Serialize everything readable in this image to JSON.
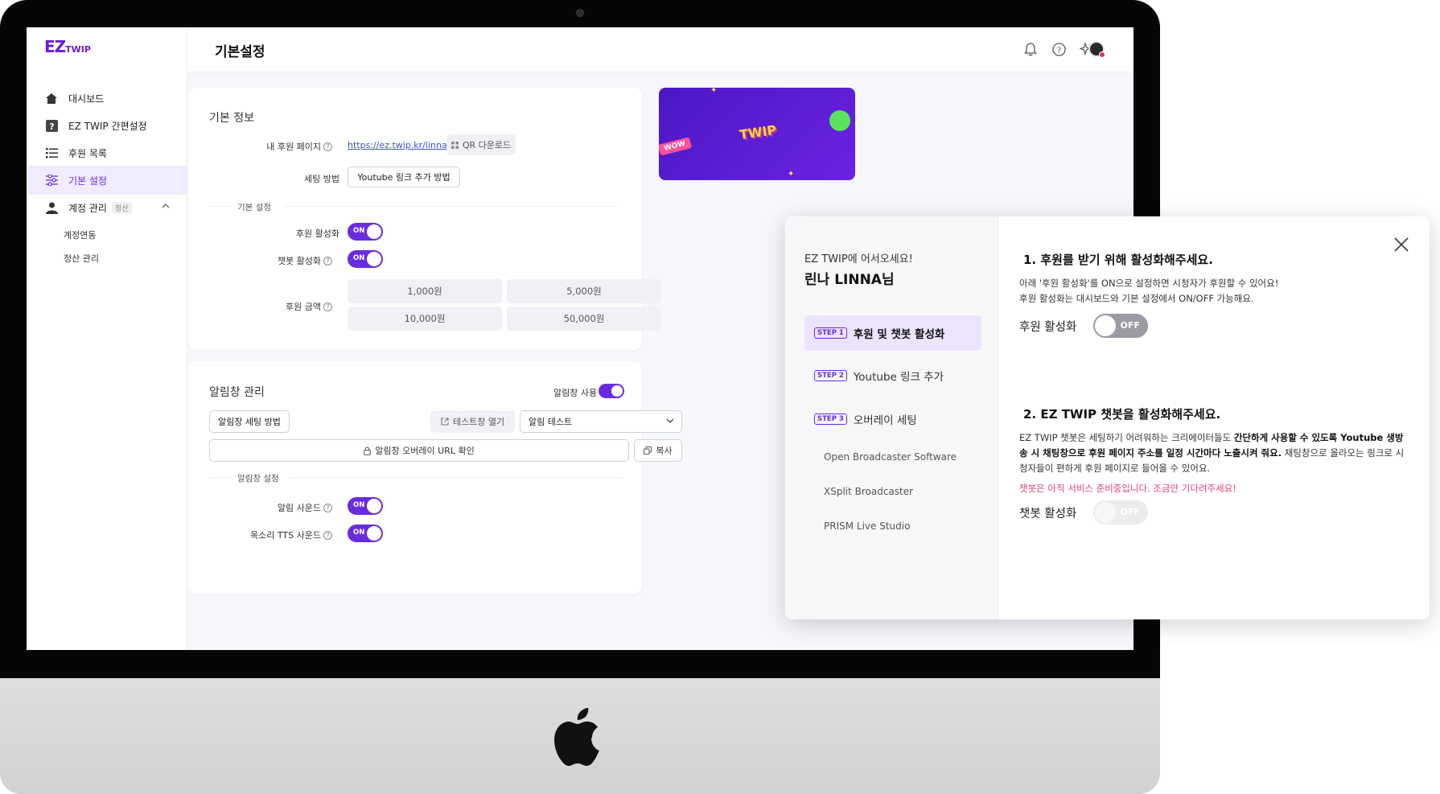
{
  "sidebar": {
    "logo": "EZ",
    "logo_sub": "TWIP",
    "items": [
      {
        "label": "대시보드",
        "icon": "home-icon"
      },
      {
        "label": "EZ TWIP 간편설정",
        "icon": "question-box-icon"
      },
      {
        "label": "후원 목록",
        "icon": "list-icon"
      },
      {
        "label": "기본 설정",
        "icon": "sliders-icon"
      },
      {
        "label": "계정 관리",
        "icon": "user-icon",
        "badge": "정산"
      }
    ],
    "sub_items": [
      "계정연동",
      "정산 관리"
    ]
  },
  "header": {
    "title": "기본설정",
    "icons": [
      "bell-icon",
      "help-icon",
      "sparkle-icon",
      "avatar"
    ]
  },
  "basic_info": {
    "title": "기본 정보",
    "page_label": "내 후원 페이지",
    "page_url": "https://ez.twip.kr/linna_",
    "qr_button": "QR 다운로드",
    "setting_label": "세팅 방법",
    "youtube_button": "Youtube 링크 추가 방법",
    "section_label": "기본 설정",
    "donation_toggle_label": "후원 활성화",
    "chatbot_toggle_label": "챗봇 활성화",
    "amount_label": "후원 금액",
    "amounts": [
      "1,000원",
      "5,000원",
      "10,000원",
      "50,000원"
    ],
    "toggle_on_text": "ON"
  },
  "alert": {
    "title": "알림창 관리",
    "use_label": "알림창 사용",
    "setting_button": "알림창 세팅 방법",
    "test_open_button": "테스트창 열기",
    "test_select": "알림 테스트",
    "url_button": "알림창 오버레이 URL 확인",
    "copy_button": "복사",
    "section_label": "알림창 설정",
    "sound_label": "알림 사운드",
    "tts_label": "목소리 TTS 사운드",
    "toggle_on_text": "ON"
  },
  "banner": {
    "word": "TWIP",
    "badge": "WOW"
  },
  "dialog": {
    "welcome": "EZ TWIP에 어서오세요!",
    "user_name": "린나 LINNA님",
    "steps": [
      {
        "tag": "STEP 1",
        "label": "후원 및 챗봇 활성화"
      },
      {
        "tag": "STEP 2",
        "label": "Youtube 링크 추가"
      },
      {
        "tag": "STEP 3",
        "label": "오버레이 세팅"
      }
    ],
    "sub_steps": [
      "Open Broadcaster Software",
      "XSplit Broadcaster",
      "PRISM Live Studio"
    ],
    "section1_title": "1. 후원를 받기 위해 활성화해주세요.",
    "section1_line1": "아래 '후원 활성화'를 ON으로 설정하면 시청자가 후원할 수 있어요!",
    "section1_line2": "후원 활성화는 대시보드와 기본 설정에서 ON/OFF 가능해요.",
    "section1_toggle_label": "후원 활성화",
    "section2_title": "2. EZ TWIP 챗봇을 활성화해주세요.",
    "section2_pre": "EZ TWIP 챗봇은 세팅하기 어려워하는 크리에이터들도 ",
    "section2_bold": "간단하게 사용할 수 있도록 Youtube 생방송 시 채팅창으로 후원 페이지 주소를 일정 시간마다 노출시켜 줘요.",
    "section2_post": " 채팅창으로 올라오는 링크로 시청자들이 편하게 후원 페이지로 들어올 수 있어요.",
    "section2_warning": "챗봇은 아직 서비스 준비중입니다. 조금만 기다려주세요!",
    "section2_toggle_label": "챗봇 활성화",
    "toggle_off_text": "OFF"
  }
}
